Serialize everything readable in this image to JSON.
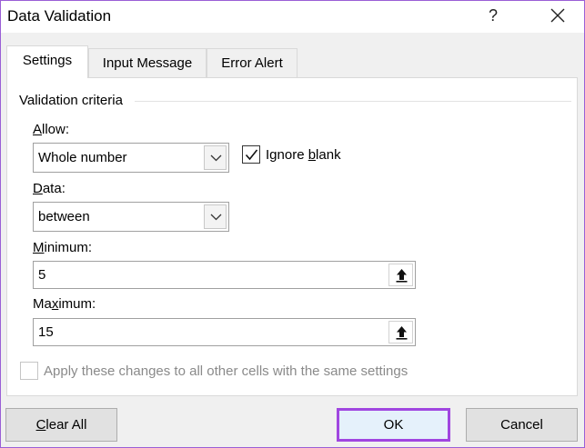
{
  "window": {
    "title": "Data Validation",
    "help_glyph": "?"
  },
  "tabs": [
    {
      "label": "Settings",
      "active": true
    },
    {
      "label": "Input Message",
      "active": false
    },
    {
      "label": "Error Alert",
      "active": false
    }
  ],
  "settings": {
    "group_label": "Validation criteria",
    "allow": {
      "label_accel": "A",
      "label_rest": "llow:",
      "value": "Whole number"
    },
    "ignore_blank": {
      "label_pre": "Ignore ",
      "label_accel": "b",
      "label_post": "lank",
      "checked": true
    },
    "data": {
      "label_accel": "D",
      "label_rest": "ata:",
      "value": "between"
    },
    "minimum": {
      "label_accel": "M",
      "label_rest": "inimum:",
      "value": "5"
    },
    "maximum": {
      "label_pre": "Ma",
      "label_accel": "x",
      "label_rest": "imum:",
      "value": "15"
    },
    "apply_all": {
      "label": "Apply these changes to all other cells with the same settings",
      "checked": false,
      "disabled": true
    }
  },
  "footer": {
    "clear_all_accel": "C",
    "clear_all_rest": "lear All",
    "ok_label": "OK",
    "cancel_label": "Cancel"
  },
  "colors": {
    "highlight": "#a046e0"
  }
}
